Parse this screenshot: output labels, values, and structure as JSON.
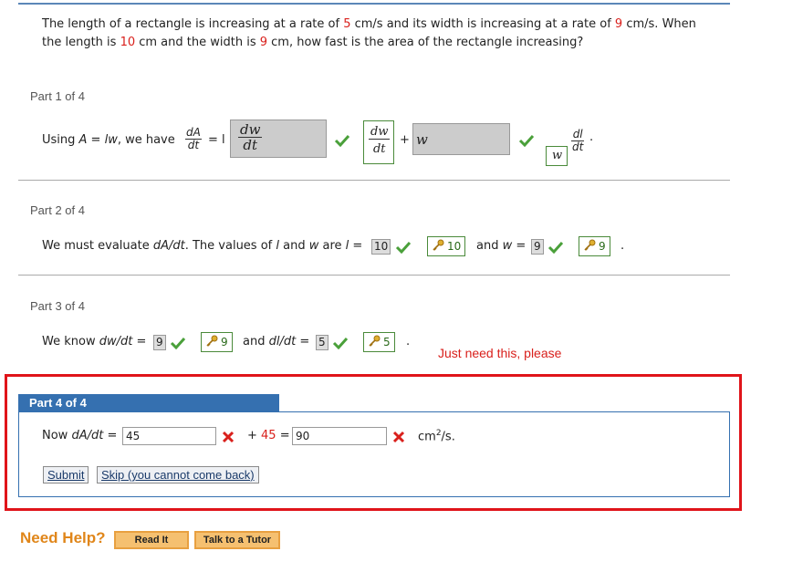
{
  "problem": {
    "s1": "The length of a rectangle is increasing at a rate of ",
    "v1": "5",
    "s2": " cm/s and its width is increasing at a rate of ",
    "v2": "9",
    "s3": " cm/s. When",
    "s4": "the length is ",
    "v3": "10",
    "s5": " cm and the width is ",
    "v4": "9",
    "s6": " cm, how fast is the area of the rectangle increasing?"
  },
  "part1": {
    "title": "Part 1 of 4",
    "lead": "Using ",
    "formula": "A = lw",
    "mid": ", we have",
    "dA_num": "dA",
    "dA_den": "dt",
    "eq": "= l",
    "plus": "+",
    "box1_num": "dw",
    "box1_den": "dt",
    "ans1_num": "dw",
    "ans1_den": "dt",
    "box2_value": "w",
    "ans2_value": "w",
    "dl_num": "dl",
    "dl_den": "dt",
    "end": "."
  },
  "part2": {
    "title": "Part 2 of 4",
    "lead": "We must evaluate ",
    "what": "dA/dt",
    "mid": ". The values of ",
    "l": "l",
    "and": " and ",
    "w": "w",
    "are": " are ",
    "l_eq": "l =",
    "l_input": "10",
    "l_answer": "10",
    "and2": "and",
    "w_eq": "w =",
    "w_input": "9",
    "w_answer": "9",
    "end": "."
  },
  "part3": {
    "title": "Part 3 of 4",
    "lead": "We know ",
    "dwdt": "dw/dt",
    "eq": "=",
    "dw_input": "9",
    "dw_answer": "9",
    "and": "and ",
    "dldt": "dl/dt",
    "eq2": "=",
    "dl_input": "5",
    "dl_answer": "5",
    "end": "."
  },
  "annotation": "Just need this, please",
  "part4": {
    "title": "Part 4 of 4",
    "lead": "Now ",
    "dadt": "dA/dt",
    "eq": "=",
    "input1": "45",
    "plus": "+ ",
    "plus_value": "45",
    "eq2": "=",
    "input2": "90",
    "unit": "cm",
    "unit_exp": "2",
    "unit_tail": "/s.",
    "submit": "Submit",
    "skip": "Skip (you cannot come back)"
  },
  "help": {
    "label": "Need Help?",
    "read": "Read It",
    "tutor": "Talk to a Tutor"
  },
  "colors": {
    "accent_blue": "#3570b0",
    "highlight_red": "#e0141a",
    "correct_green": "#4a8a3a",
    "help_orange": "#e0861a"
  }
}
